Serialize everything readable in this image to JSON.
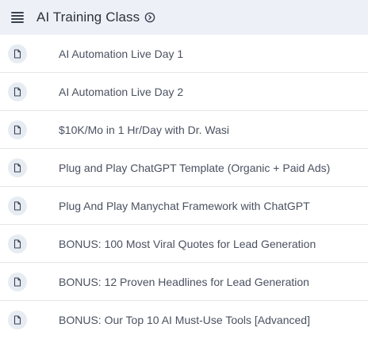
{
  "header": {
    "title": "AI Training Class",
    "menu_icon": "hamburger-menu-icon",
    "title_icon": "circle-chevron-icon"
  },
  "lessons": [
    {
      "label": "AI Automation Live Day 1",
      "icon": "document-icon"
    },
    {
      "label": "AI Automation Live Day 2",
      "icon": "document-icon"
    },
    {
      "label": "$10K/Mo in 1 Hr/Day with Dr. Wasi",
      "icon": "document-icon"
    },
    {
      "label": "Plug and Play ChatGPT Template (Organic + Paid Ads)",
      "icon": "document-icon"
    },
    {
      "label": "Plug And Play Manychat Framework with ChatGPT",
      "icon": "document-icon"
    },
    {
      "label": "BONUS: 100 Most Viral Quotes for Lead Generation",
      "icon": "document-icon"
    },
    {
      "label": "BONUS: 12 Proven Headlines for Lead Generation",
      "icon": "document-icon"
    },
    {
      "label": "BONUS: Our Top 10 AI Must-Use Tools [Advanced]",
      "icon": "document-icon"
    }
  ],
  "colors": {
    "header_bg": "#edf1f7",
    "badge_bg": "#e7ecf3",
    "divider": "#e3e6ea",
    "text": "#4a5160"
  }
}
